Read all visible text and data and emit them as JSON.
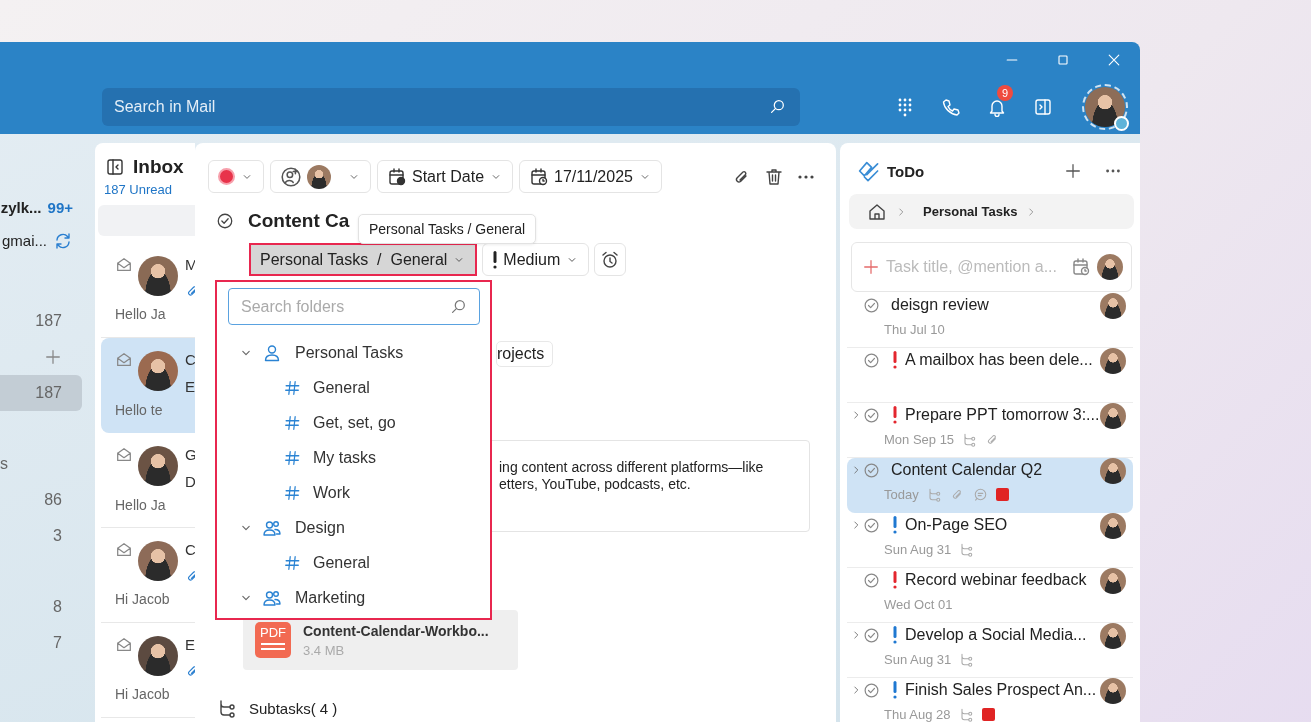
{
  "titlebar": {
    "search": {
      "placeholder": "Search in Mail"
    },
    "notification_count": "9"
  },
  "sidebar": {
    "accounts": [
      {
        "name": "zylk...",
        "badge": "99+",
        "syncing": false
      },
      {
        "name": "gmai...",
        "syncing": true
      }
    ],
    "folder_groups": [
      [
        {
          "kind": "folder",
          "count": "187",
          "selected": false
        },
        {
          "kind": "add",
          "selected": false
        },
        {
          "kind": "folder",
          "count": "187",
          "selected": true
        }
      ],
      [
        {
          "kind": "folder",
          "label": "s",
          "selected": false
        },
        {
          "kind": "folder",
          "count": "86",
          "selected": false
        },
        {
          "kind": "folder",
          "count": "3",
          "selected": false
        }
      ],
      [
        {
          "kind": "folder",
          "count": "8",
          "selected": false
        },
        {
          "kind": "folder",
          "count": "7",
          "selected": false
        }
      ]
    ]
  },
  "mail_list": {
    "title": "Inbox",
    "unread": "187 Unread",
    "messages": [
      {
        "sender": "M",
        "attachment": true,
        "preview": "Hello Ja",
        "selected": false
      },
      {
        "sender": "C",
        "subject": "E",
        "attachment": false,
        "preview": "Hello te",
        "selected": true
      },
      {
        "sender": "G",
        "subject": "D",
        "attachment": false,
        "preview": "Hello Ja",
        "selected": false
      },
      {
        "sender": "C",
        "attachment": true,
        "preview": "Hi Jacob",
        "selected": false
      },
      {
        "sender": "E",
        "attachment": true,
        "preview": "Hi Jacob",
        "selected": false
      }
    ]
  },
  "task_detail": {
    "toolbar": {
      "color": "#e8334a",
      "start_date": "Start Date",
      "due_date": "17/11/2025"
    },
    "title": "Content Ca",
    "tooltip": "Personal Tasks / General",
    "folder": "Personal Tasks  /  General",
    "priority": "Medium",
    "folder_dropdown": {
      "search": {
        "placeholder": "Search folders"
      },
      "tree": [
        {
          "label": "Personal Tasks",
          "kind": "personal",
          "expanded": true,
          "children": [
            {
              "label": "General"
            },
            {
              "label": "Get, set, go"
            },
            {
              "label": "My tasks"
            },
            {
              "label": "Work"
            }
          ]
        },
        {
          "label": "Design",
          "kind": "team",
          "expanded": true,
          "children": [
            {
              "label": "General"
            }
          ]
        },
        {
          "label": "Marketing",
          "kind": "team",
          "expanded": true
        }
      ]
    },
    "tag": "rojects",
    "description": "ing content across different platforms—like\netters, YouTube, podcasts, etc.",
    "attachment": {
      "type": "PDF",
      "name": "Content-Calendar-Workbo...",
      "size": "3.4 MB"
    },
    "subtasks": "Subtasks( 4 )"
  },
  "todo": {
    "title": "ToDo",
    "breadcrumb": "Personal Tasks",
    "new_task": {
      "placeholder": "Task title, @mention a..."
    },
    "tasks": [
      {
        "title": "deisgn review",
        "date": "Thu Jul 10",
        "expandable": false,
        "subtasks": false,
        "attachment": false,
        "comment": false,
        "selected": false
      },
      {
        "title": "A mailbox has been dele...",
        "priority": {
          "color": "#e3262e"
        },
        "expandable": false,
        "subtasks": false,
        "attachment": false,
        "comment": false,
        "selected": false
      },
      {
        "title": "Prepare PPT tomorrow 3:...",
        "priority": {
          "color": "#e3262e"
        },
        "date": "Mon Sep 15",
        "expandable": true,
        "subtasks": true,
        "attachment": true,
        "comment": false,
        "selected": false
      },
      {
        "title": "Content Calendar Q2",
        "date": "Today",
        "expandable": true,
        "subtasks": true,
        "attachment": true,
        "comment": true,
        "selected": true,
        "color": "#e02424"
      },
      {
        "title": "On-Page SEO",
        "priority": {
          "color": "#1f78d1"
        },
        "date": "Sun Aug 31",
        "expandable": true,
        "subtasks": true,
        "attachment": false,
        "comment": false,
        "selected": false
      },
      {
        "title": "Record webinar feedback",
        "priority": {
          "color": "#e3262e"
        },
        "date": "Wed Oct 01",
        "expandable": false,
        "subtasks": false,
        "attachment": false,
        "comment": false,
        "selected": false
      },
      {
        "title": "Develop a Social Media...",
        "priority": {
          "color": "#1f78d1"
        },
        "date": "Sun Aug 31",
        "expandable": true,
        "subtasks": true,
        "attachment": false,
        "comment": false,
        "selected": false
      },
      {
        "title": "Finish Sales Prospect An...",
        "priority": {
          "color": "#1f78d1"
        },
        "date": "Thu Aug 28",
        "expandable": true,
        "subtasks": true,
        "attachment": false,
        "comment": false,
        "selected": false,
        "color": "#e02424"
      }
    ]
  }
}
